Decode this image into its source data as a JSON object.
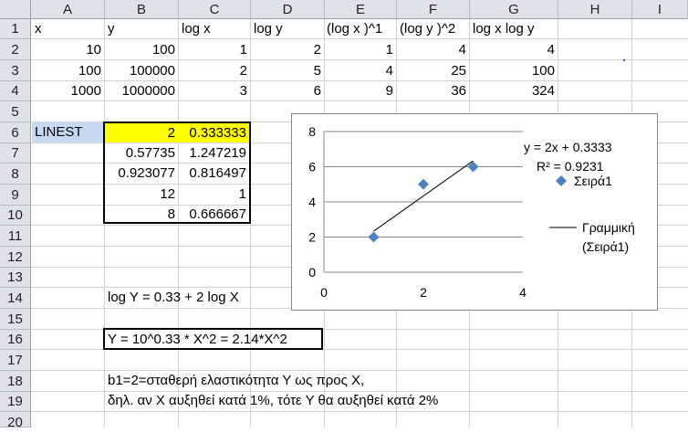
{
  "columns": [
    "A",
    "B",
    "C",
    "D",
    "E",
    "F",
    "G",
    "H",
    "I"
  ],
  "rows": [
    "1",
    "2",
    "3",
    "4",
    "5",
    "6",
    "7",
    "8",
    "9",
    "10",
    "11",
    "12",
    "13",
    "14",
    "15",
    "16",
    "17",
    "18",
    "19",
    "20"
  ],
  "header_row": [
    "x",
    "y",
    "log x",
    "log y",
    "(log x )^1",
    "(log y )^2",
    "log x  log y"
  ],
  "data_rows": [
    [
      "10",
      "100",
      "1",
      "2",
      "1",
      "4",
      "4"
    ],
    [
      "100",
      "100000",
      "2",
      "5",
      "4",
      "25",
      "100"
    ],
    [
      "1000",
      "1000000",
      "3",
      "6",
      "9",
      "36",
      "324"
    ]
  ],
  "linest_label": "LINEST",
  "linest": [
    [
      "2",
      "0.333333"
    ],
    [
      "0.57735",
      "1.247219"
    ],
    [
      "0.923077",
      "0.816497"
    ],
    [
      "12",
      "1"
    ],
    [
      "8",
      "0.666667"
    ]
  ],
  "formula_row14": "log Y = 0.33 + 2 log X",
  "formula_row16": "Y = 10^0.33 * X^2 = 2.14*X^2",
  "note_row18": "b1=2=σταθερή ελαστικότητα Υ ως προς Χ,",
  "note_row19": "δηλ. αν Χ αυξηθεί κατά 1%, τότε Υ θα αυξηθεί κατά 2%",
  "colors": {
    "highlight": "#ffff00",
    "linest_label_bg": "#c6d9f1",
    "series_marker": "#4f81bd",
    "header_bg": "#dfe3e8"
  },
  "chart_data": {
    "type": "scatter",
    "series": [
      {
        "name": "Σειρά1",
        "x": [
          1,
          2,
          3
        ],
        "y": [
          2,
          5,
          6
        ]
      }
    ],
    "trendline": {
      "name": "Γραμμική (Σειρά1)",
      "slope": 2,
      "intercept": 0.3333,
      "x_range": [
        1,
        3
      ]
    },
    "equation_label": "y = 2x + 0.3333",
    "r2_label": "R² = 0.9231",
    "xlim": [
      0,
      4
    ],
    "ylim": [
      0,
      8
    ],
    "x_ticks": [
      "0",
      "2",
      "4"
    ],
    "y_ticks": [
      "0",
      "2",
      "4",
      "6",
      "8"
    ],
    "legend": [
      "Σειρά1",
      "Γραμμική",
      "(Σειρά1)"
    ],
    "grid": true,
    "legend_position": "right"
  }
}
